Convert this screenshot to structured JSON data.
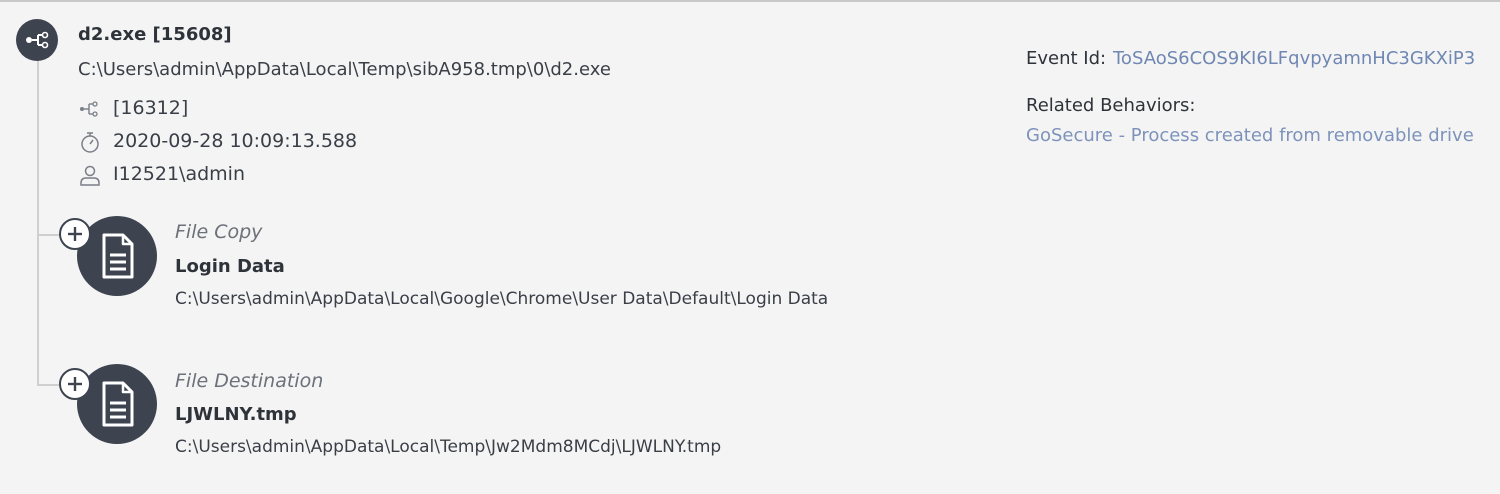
{
  "process": {
    "title": "d2.exe [15608]",
    "path": "C:\\Users\\admin\\AppData\\Local\\Temp\\sibA958.tmp\\0\\d2.exe",
    "icon": "process-tree-icon",
    "parent_pid": "[16312]",
    "parent_pid_icon": "process-tree-icon",
    "timestamp": "2020-09-28 10:09:13.588",
    "timestamp_icon": "stopwatch-icon",
    "user": "I12521\\admin",
    "user_icon": "user-icon"
  },
  "details": {
    "event_id_label": "Event Id:",
    "event_id_value": "ToSAoS6COS9KI6LFqvpyamnHC3GKXiP3",
    "related_label": "Related Behaviors:",
    "related_link": "GoSecure - Process created from removable drive"
  },
  "children": [
    {
      "kind": "File Copy",
      "name": "Login Data",
      "path": "C:\\Users\\admin\\AppData\\Local\\Google\\Chrome\\User Data\\Default\\Login Data",
      "icon": "document-icon",
      "expand_icon": "plus-icon"
    },
    {
      "kind": "File Destination",
      "name": "LJWLNY.tmp",
      "path": "C:\\Users\\admin\\AppData\\Local\\Temp\\Jw2Mdm8MCdj\\LJWLNY.tmp",
      "icon": "document-icon",
      "expand_icon": "plus-icon"
    }
  ],
  "colors": {
    "background": "#f4f4f4",
    "icon_circle": "#3d4450",
    "link": "#7d93bb",
    "text": "#3a3f47"
  }
}
